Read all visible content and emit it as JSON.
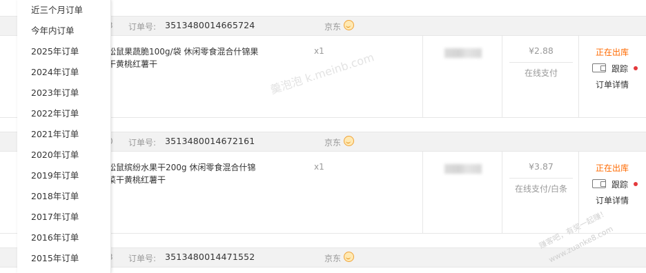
{
  "dropdown": {
    "items": [
      "近三个月订单",
      "今年内订单",
      "2025年订单",
      "2024年订单",
      "2023年订单",
      "2022年订单",
      "2021年订单",
      "2020年订单",
      "2019年订单",
      "2018年订单",
      "2017年订单",
      "2016年订单",
      "2015年订单"
    ]
  },
  "orders": [
    {
      "date_fragment": "3",
      "order_no_label": "订单号:",
      "order_no": "3513480014665724",
      "shop": "京东",
      "title_line1": "松鼠果蔬脆100g/袋 休闲零食混合什锦果",
      "title_line2": "干黄桃红薯干",
      "qty": "x1",
      "price": "¥2.88",
      "payment": "在线支付",
      "status": "正在出库",
      "track_label": "跟踪",
      "detail_label": "订单详情"
    },
    {
      "date_fragment": "0",
      "order_no_label": "订单号:",
      "order_no": "3513480014672161",
      "shop": "京东",
      "title_line1": "松鼠缤纷水果干200g 休闲零食混合什锦",
      "title_line2": "菜干黄桃红薯干",
      "qty": "x1",
      "price": "¥3.87",
      "payment": "在线支付/白条",
      "status": "正在出库",
      "track_label": "跟踪",
      "detail_label": "订单详情"
    },
    {
      "date_fragment": "3",
      "order_no_label": "订单号:",
      "order_no": "3513480014471552",
      "shop": "京东"
    }
  ],
  "watermark": {
    "main": "羹泡泡 k.meinb.com",
    "corner_line1": "赚客吧，有奖一起赚！",
    "corner_line2": "www.zuanke8.com"
  },
  "colors": {
    "status": "#ff6a00",
    "dot": "#e4393c",
    "header_bg": "#f2f2f2"
  },
  "icons": [
    "smile-icon",
    "truck-icon"
  ]
}
